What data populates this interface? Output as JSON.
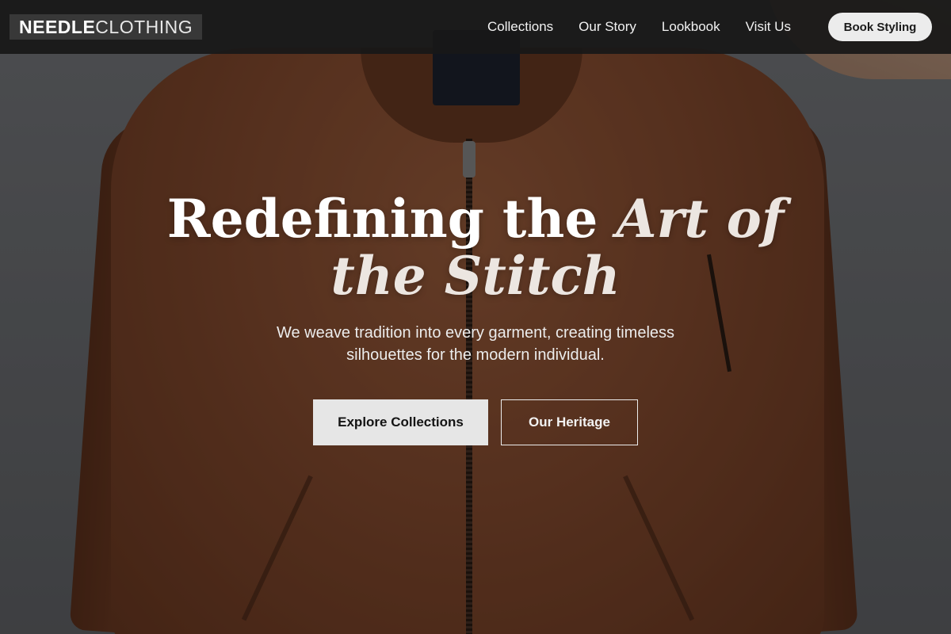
{
  "nav": {
    "logo_bold": "NEEDLE",
    "logo_light": "CLOTHING",
    "links": [
      "Collections",
      "Our Story",
      "Lookbook",
      "Visit Us"
    ],
    "cta": "Book Styling"
  },
  "hero": {
    "headline_plain": "Redefining the ",
    "headline_accent": "Art of the Stitch",
    "subtitle": "We weave tradition into every garment, creating timeless silhouettes for the modern individual.",
    "primary_cta": "Explore Collections",
    "secondary_cta": "Our Heritage"
  },
  "colors": {
    "nav_bg": "#181818",
    "jacket": "#8a4e31",
    "button_light": "#e6e6e6"
  }
}
